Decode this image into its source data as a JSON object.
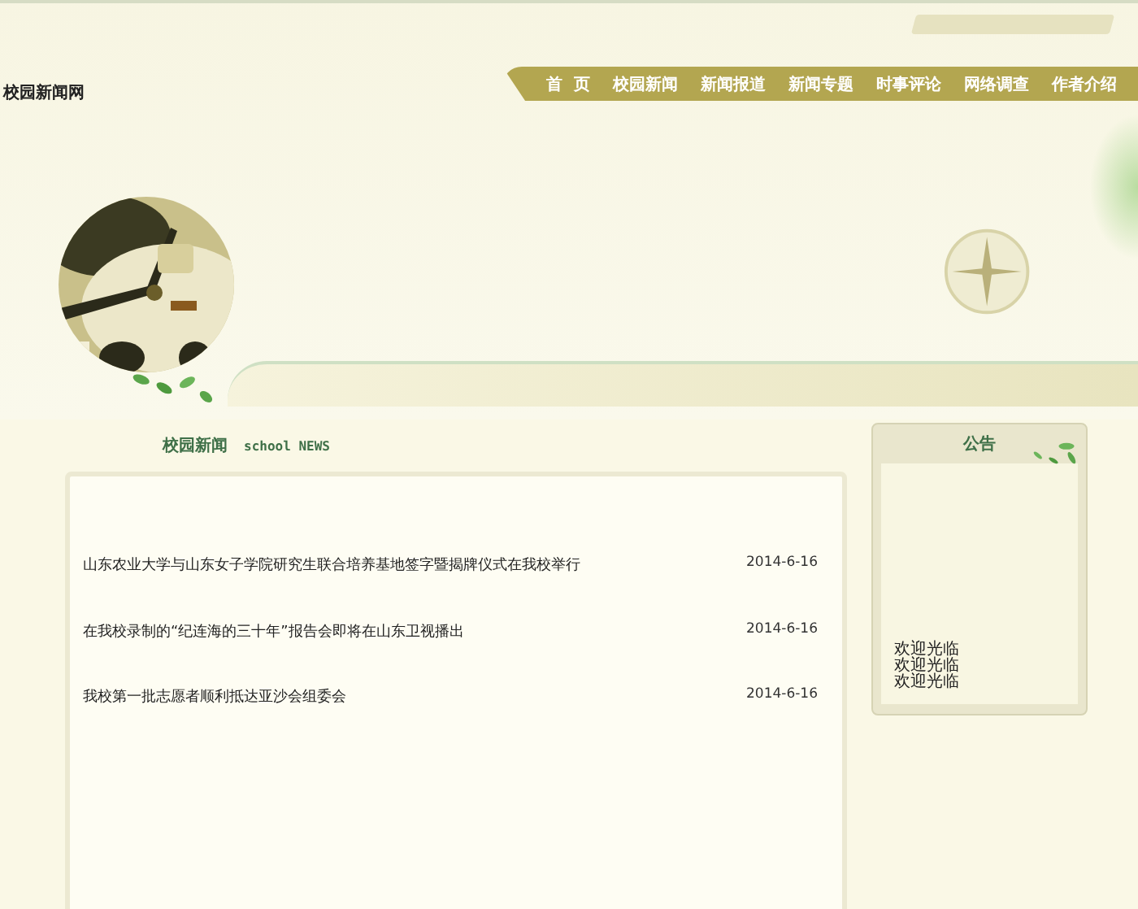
{
  "site_title": "校园新闻网",
  "nav": [
    {
      "label": "首  页"
    },
    {
      "label": "校园新闻"
    },
    {
      "label": "新闻报道"
    },
    {
      "label": "新闻专题"
    },
    {
      "label": "时事评论"
    },
    {
      "label": "网络调查"
    },
    {
      "label": "作者介绍"
    }
  ],
  "news": {
    "title": "校园新闻",
    "subtitle": "school NEWS",
    "items": [
      {
        "title": "山东农业大学与山东女子学院研究生联合培养基地签字暨揭牌仪式在我校举行",
        "date": "2014-6-16"
      },
      {
        "title": "在我校录制的“纪连海的三十年”报告会即将在山东卫视播出",
        "date": "2014-6-16"
      },
      {
        "title": "我校第一批志愿者顺利抵达亚沙会组委会",
        "date": "2014-6-16"
      }
    ]
  },
  "notice": {
    "title": "公告",
    "lines": [
      "欢迎光临",
      "欢迎光临",
      "欢迎光临"
    ]
  }
}
